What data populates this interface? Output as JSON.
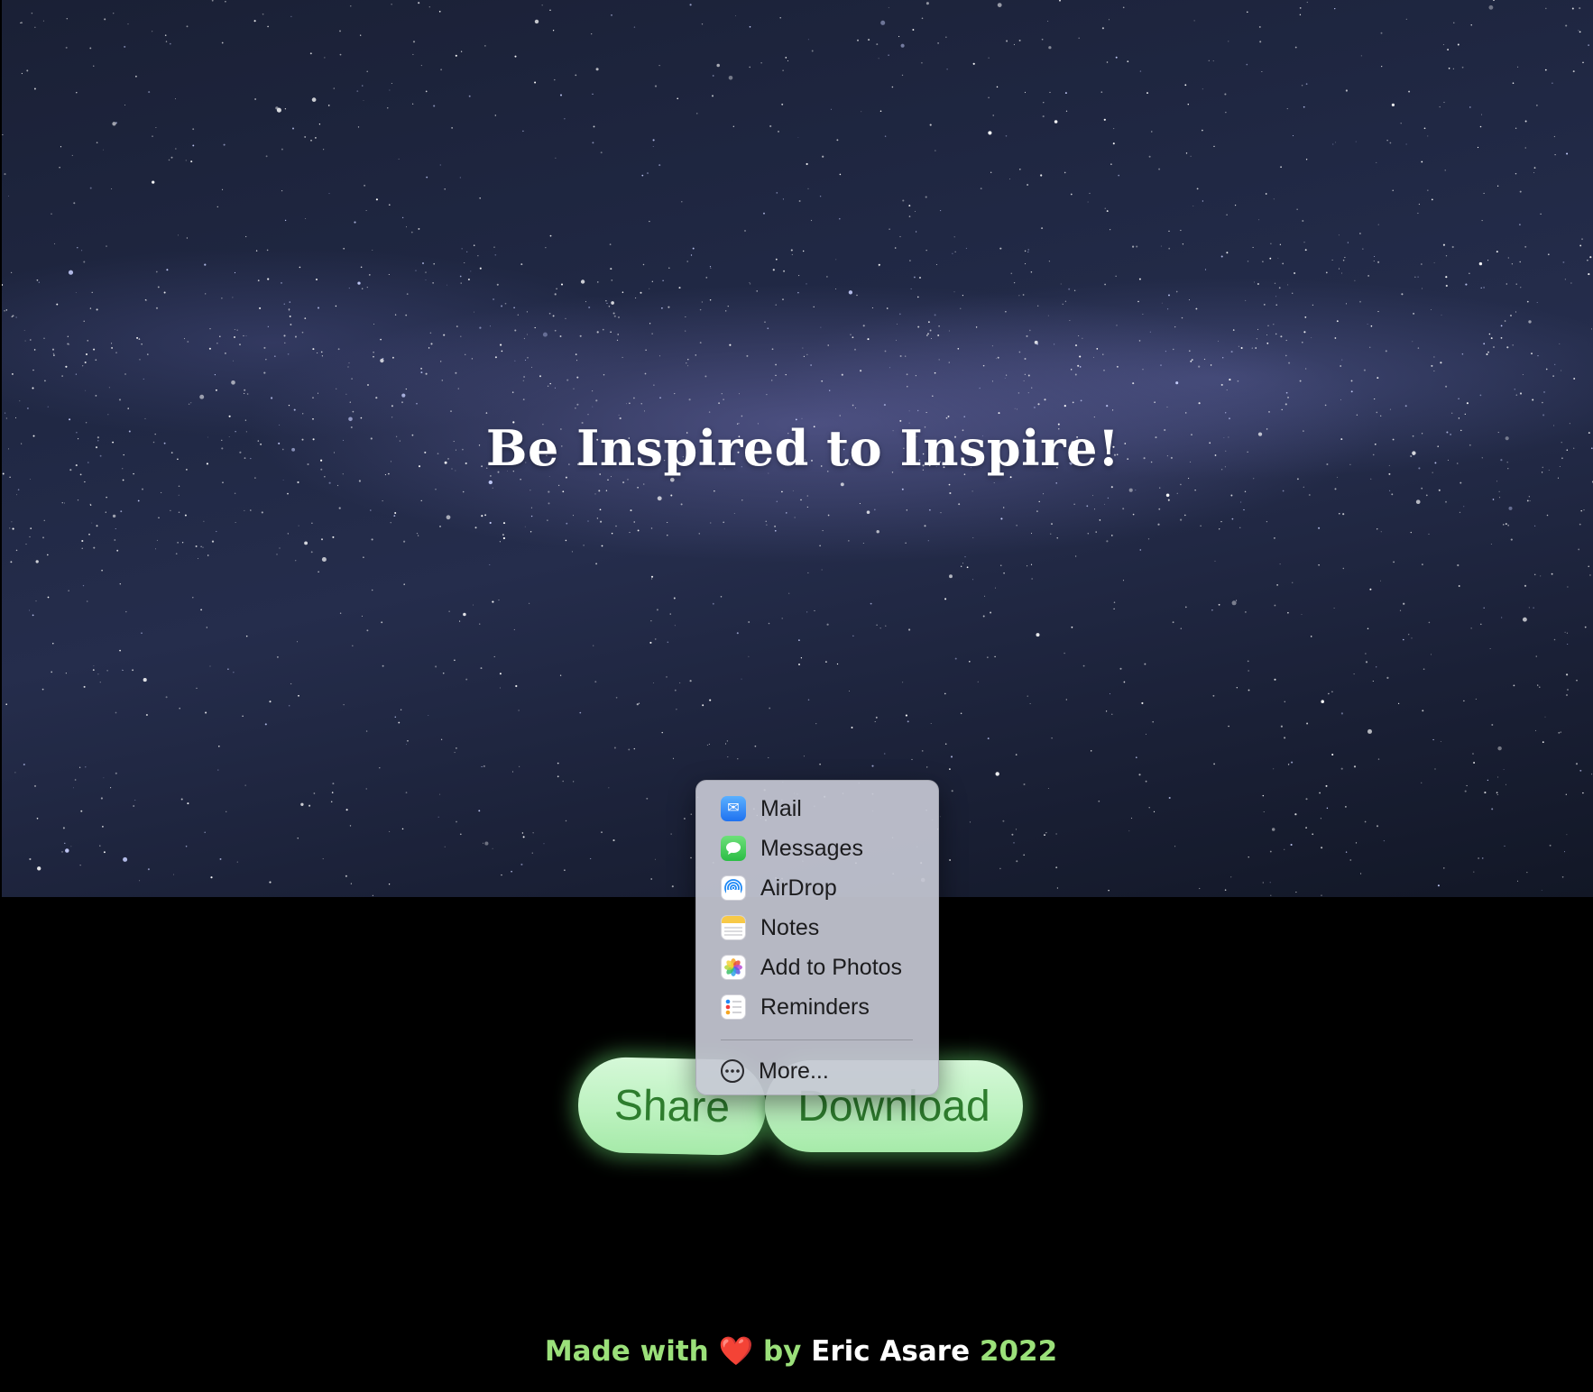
{
  "hero": {
    "title": "Be Inspired to Inspire!"
  },
  "actions": {
    "share_label": "Share",
    "download_label": "Download"
  },
  "share_menu": {
    "items": [
      {
        "label": "Mail",
        "icon": "mail-icon"
      },
      {
        "label": "Messages",
        "icon": "messages-icon"
      },
      {
        "label": "AirDrop",
        "icon": "airdrop-icon"
      },
      {
        "label": "Notes",
        "icon": "notes-icon"
      },
      {
        "label": "Add to Photos",
        "icon": "photos-icon"
      },
      {
        "label": "Reminders",
        "icon": "reminders-icon"
      }
    ],
    "more_label": "More..."
  },
  "footer": {
    "prefix": "Made with",
    "heart": "❤️",
    "by": "by",
    "author": "Eric Asare",
    "year": "2022"
  },
  "colors": {
    "button_bg": "#bdf2c0",
    "button_text": "#2e7d2e",
    "footer_text": "#9be07a"
  }
}
